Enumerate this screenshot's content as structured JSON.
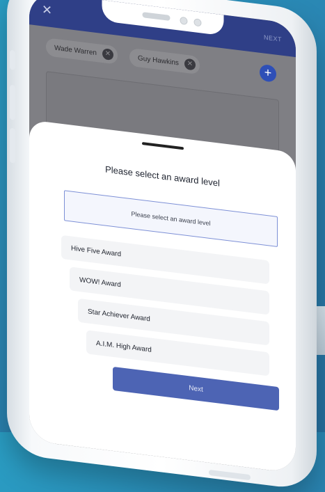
{
  "top_bar": {
    "next_label": "NEXT"
  },
  "recipients": [
    {
      "name": "Wade Warren"
    },
    {
      "name": "Guy Hawkins"
    }
  ],
  "sheet": {
    "title": "Please select an award level",
    "select_placeholder": "Please select an award level",
    "options": [
      "Hive Five Award",
      "WOW! Award",
      "Star Achiever Award",
      "A.I.M. High Award"
    ],
    "next_button": "Next"
  },
  "colors": {
    "header": "#2f3f87",
    "accent": "#4d64b4",
    "select_border": "#7c8fd6"
  },
  "icons": {
    "close": "close-icon",
    "remove_chip": "close-circle-icon",
    "add": "plus-circle-icon"
  }
}
